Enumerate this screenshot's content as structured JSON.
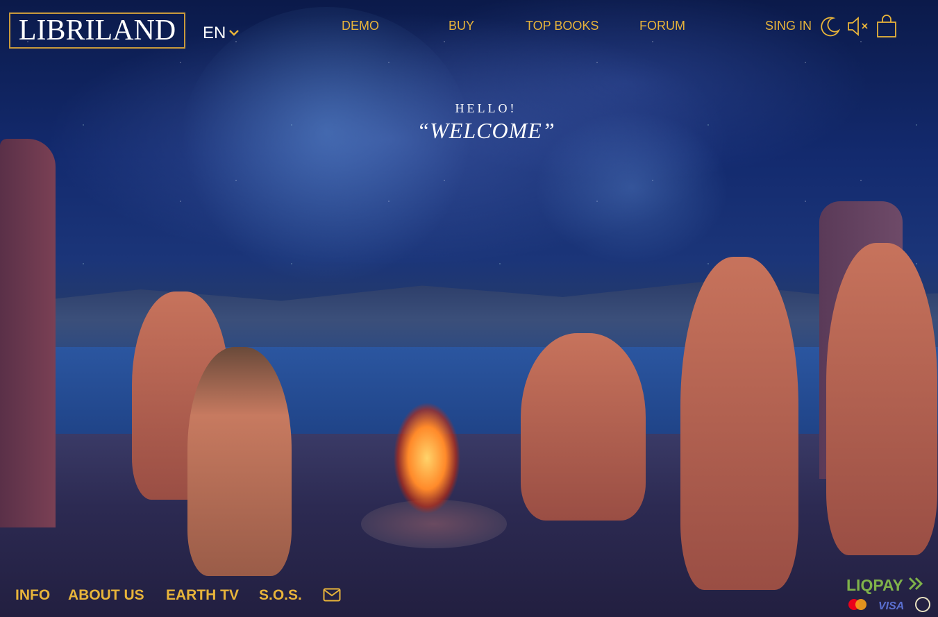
{
  "header": {
    "logo": "LIBRILAND",
    "language": "EN",
    "nav": [
      "DEMO",
      "BUY",
      "TOP BOOKS",
      "FORUM"
    ],
    "signin": "SING IN"
  },
  "hero": {
    "greeting": "HELLO!",
    "welcome": "“WELCOME”"
  },
  "footer": {
    "links": [
      "INFO",
      "ABOUT US",
      "EARTH TV",
      "S.O.S."
    ],
    "payment_provider": "LIQPAY",
    "card_visa": "VISA"
  },
  "icons": {
    "theme": "moon-icon",
    "sound": "mute-icon",
    "cart": "shopping-bag-icon",
    "mail": "mail-icon",
    "language": "chevron-down-icon"
  },
  "colors": {
    "accent": "#e8b43a",
    "liqpay": "#7fb24a"
  }
}
